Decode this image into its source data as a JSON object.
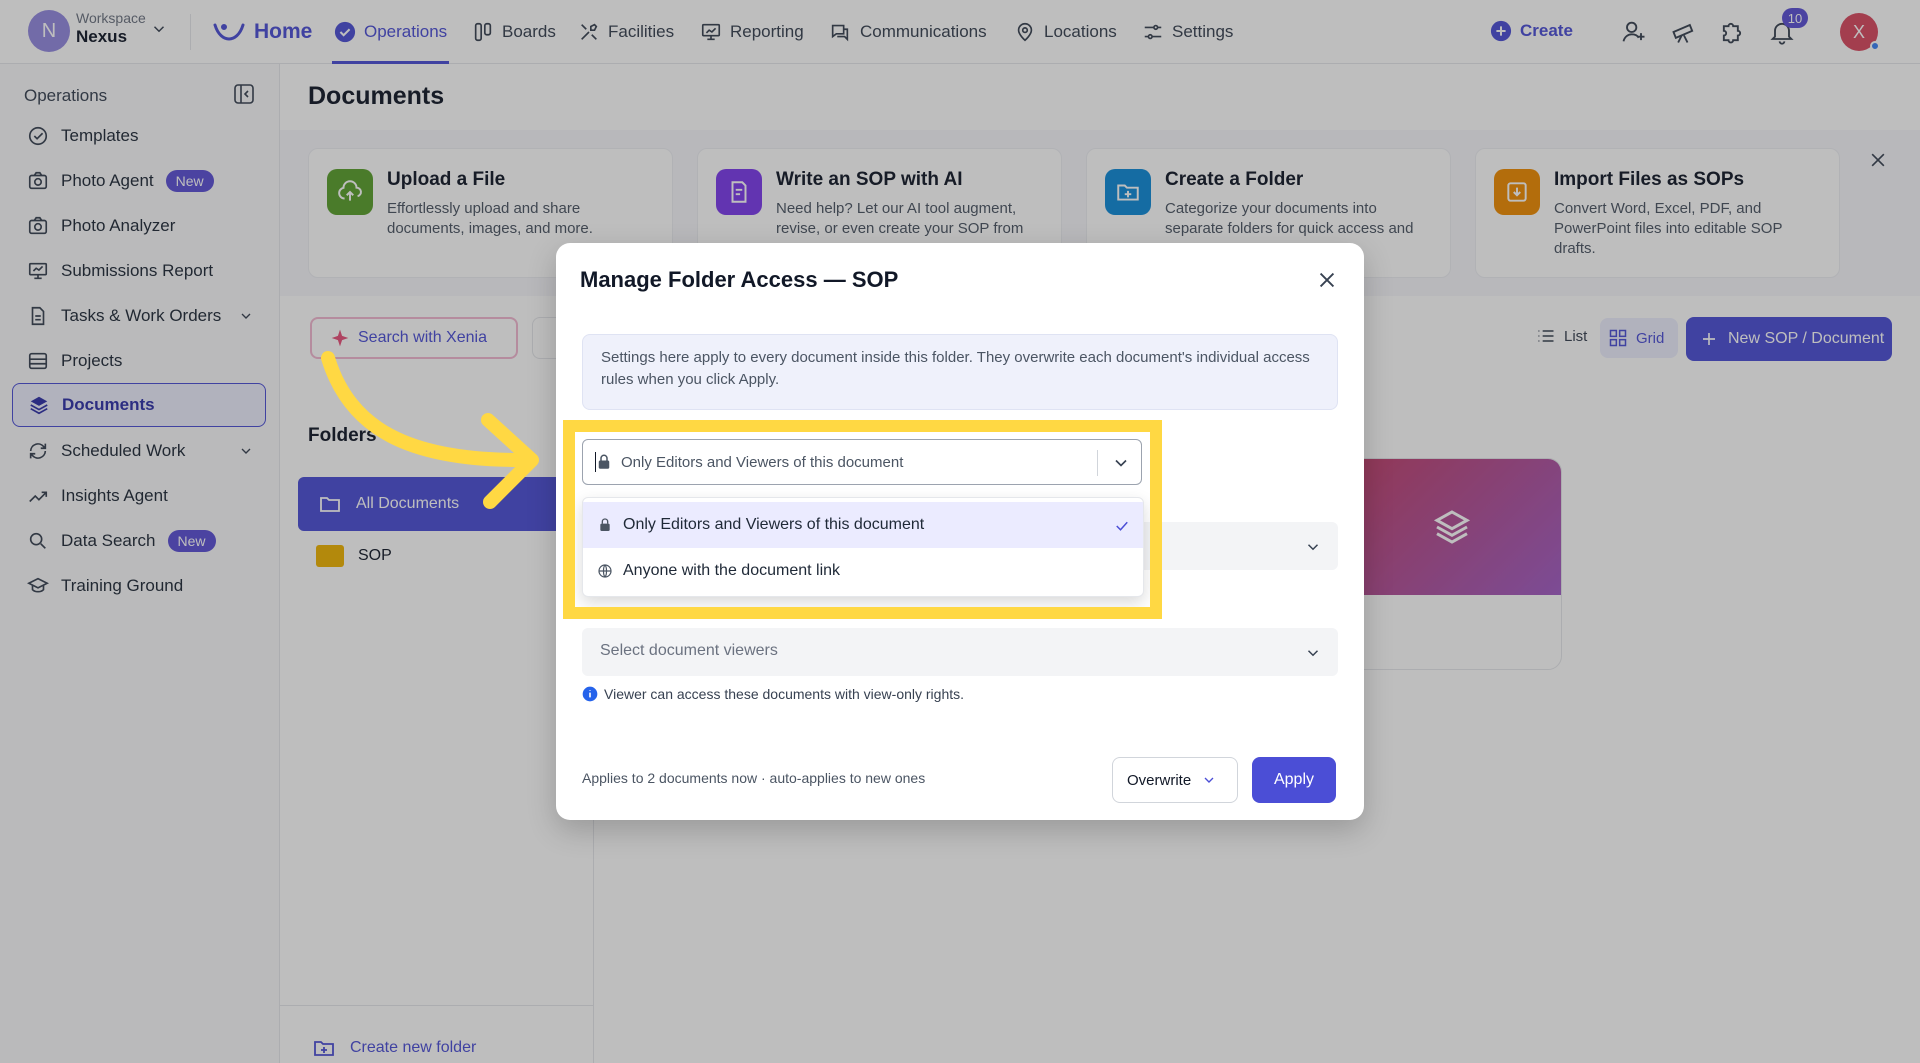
{
  "workspace": {
    "label": "Workspace",
    "name": "Nexus",
    "initial": "N"
  },
  "nav": [
    {
      "label": "Home",
      "icon": "home-logo-icon"
    },
    {
      "label": "Operations",
      "icon": "check-circle-icon"
    },
    {
      "label": "Boards",
      "icon": "boards-icon"
    },
    {
      "label": "Facilities",
      "icon": "tools-icon"
    },
    {
      "label": "Reporting",
      "icon": "chart-board-icon"
    },
    {
      "label": "Communications",
      "icon": "chat-icon"
    },
    {
      "label": "Locations",
      "icon": "location-pin-icon"
    },
    {
      "label": "Settings",
      "icon": "sliders-icon"
    }
  ],
  "topright": {
    "create_label": "Create",
    "notification_count": "10",
    "user_initial": "X"
  },
  "sidebar": {
    "title": "Operations",
    "items": [
      {
        "label": "Templates",
        "icon": "template-check-icon"
      },
      {
        "label": "Photo Agent",
        "icon": "camera-icon",
        "badge": "New"
      },
      {
        "label": "Photo Analyzer",
        "icon": "camera-icon"
      },
      {
        "label": "Submissions Report",
        "icon": "report-icon"
      },
      {
        "label": "Tasks & Work Orders",
        "icon": "document-icon"
      },
      {
        "label": "Projects",
        "icon": "projects-icon"
      },
      {
        "label": "Documents",
        "icon": "layers-icon"
      },
      {
        "label": "Scheduled Work",
        "icon": "recurring-icon"
      },
      {
        "label": "Insights Agent",
        "icon": "trend-icon"
      },
      {
        "label": "Data Search",
        "icon": "search-icon",
        "badge": "New"
      },
      {
        "label": "Training Ground",
        "icon": "graduation-cap-icon"
      }
    ]
  },
  "page": {
    "title": "Documents"
  },
  "cards": [
    {
      "title": "Upload a File",
      "desc": "Effortlessly upload and share documents, images, and more.",
      "color": "#5aa02c"
    },
    {
      "title": "Write an SOP with AI",
      "desc": "Need help? Let our AI tool augment, revise, or even create your SOP from",
      "color": "#7c3aed"
    },
    {
      "title": "Create a Folder",
      "desc": "Categorize your documents into separate folders for quick access and",
      "color": "#0e8ad8"
    },
    {
      "title": "Import Files as SOPs",
      "desc": "Convert Word, Excel, PDF, and PowerPoint files into editable SOP drafts.",
      "color": "#f08c00"
    }
  ],
  "toolbar": {
    "search_xenia": "Search with Xenia",
    "list": "List",
    "grid": "Grid",
    "new_doc": "New SOP / Document"
  },
  "folders": {
    "title": "Folders",
    "all": "All Documents",
    "sop": "SOP",
    "create": "Create new folder"
  },
  "modal": {
    "title": "Manage Folder Access — SOP",
    "info": "Settings here apply to every document inside this folder. They overwrite each document's individual access rules when you click Apply.",
    "access_value": "Only Editors and Viewers of this document",
    "viewers_placeholder": "Select document viewers",
    "viewer_hint": "Viewer can access these documents with view-only rights.",
    "footer_note": "Applies to 2 documents now · auto-applies to new ones",
    "overwrite_label": "Overwrite",
    "apply_label": "Apply"
  },
  "dropdown": {
    "options": [
      {
        "label": "Only Editors and Viewers of this document",
        "icon": "lock-icon",
        "selected": true
      },
      {
        "label": "Anyone with the document link",
        "icon": "globe-icon",
        "selected": false
      }
    ]
  },
  "colors": {
    "accent": "#4b4ed6",
    "highlight": "#ffd843"
  }
}
